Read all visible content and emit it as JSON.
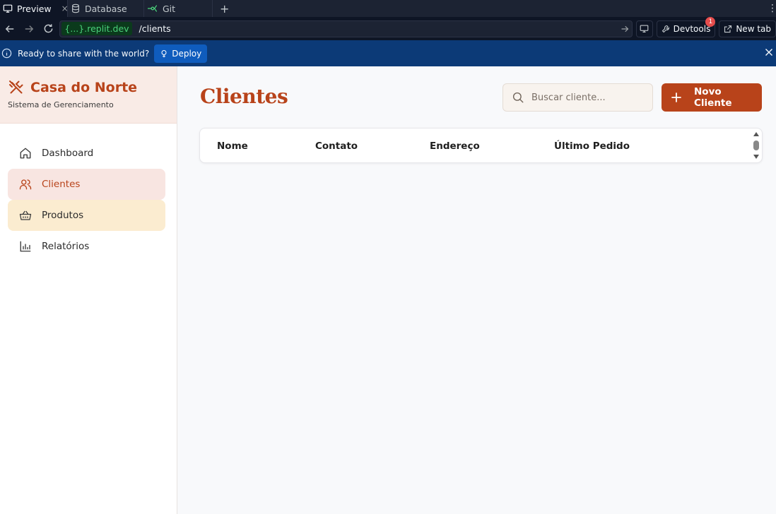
{
  "tabs": [
    {
      "label": "Preview",
      "icon": "monitor-icon",
      "active": true
    },
    {
      "label": "Database",
      "icon": "database-icon",
      "active": false
    },
    {
      "label": "Git",
      "icon": "git-branch-icon",
      "active": false
    }
  ],
  "tab_close": "×",
  "tab_add": "+",
  "url": {
    "domain": "{...}.replit.dev",
    "path": "/clients"
  },
  "toolbar": {
    "devtools_label": "Devtools",
    "devtools_badge": "1",
    "new_tab_label": "New tab"
  },
  "banner": {
    "message": "Ready to share with the world?",
    "deploy_label": "Deploy"
  },
  "brand": {
    "name": "Casa do Norte",
    "subtitle": "Sistema de Gerenciamento",
    "icon": "utensils-crossed-icon"
  },
  "nav": {
    "items": [
      {
        "label": "Dashboard",
        "icon": "home-icon"
      },
      {
        "label": "Clientes",
        "icon": "users-icon"
      },
      {
        "label": "Produtos",
        "icon": "basket-icon"
      },
      {
        "label": "Relatórios",
        "icon": "bar-chart-icon"
      }
    ]
  },
  "page": {
    "title": "Clientes",
    "search_placeholder": "Buscar cliente...",
    "new_button": "Novo Cliente",
    "new_button_icon": "+"
  },
  "table": {
    "columns": [
      "Nome",
      "Contato",
      "Endereço",
      "Último Pedido"
    ]
  },
  "colors": {
    "accent": "#b8431a",
    "banner": "#0c3a77",
    "active_nav_bg": "#f8e5e1",
    "hover_nav_bg": "#fbecd0"
  }
}
